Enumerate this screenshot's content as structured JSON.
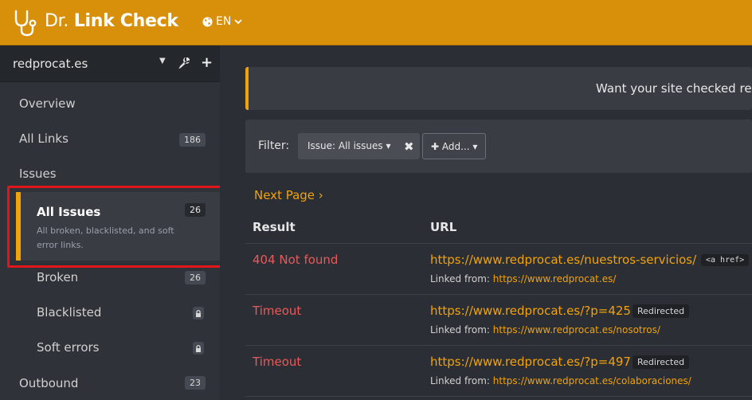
{
  "header": {
    "brand_prefix": "Dr.",
    "brand_strong": "Link Check",
    "language": "EN",
    "accent_color": "#d8900a"
  },
  "sidebar": {
    "site": "redprocat.es",
    "nav": {
      "overview": "Overview",
      "all_links": {
        "label": "All Links",
        "count": "186"
      },
      "issues": "Issues",
      "all_issues": {
        "label": "All Issues",
        "count": "26",
        "description": "All broken, blacklisted, and soft error links."
      },
      "broken": {
        "label": "Broken",
        "count": "26"
      },
      "blacklisted": {
        "label": "Blacklisted"
      },
      "soft_errors": {
        "label": "Soft errors"
      },
      "outbound": {
        "label": "Outbound",
        "count": "23"
      }
    }
  },
  "main": {
    "banner_text": "Want your site checked reg",
    "filter": {
      "label": "Filter:",
      "chip": "Issue:  All issues",
      "add": "Add..."
    },
    "next_page": "Next Page ›",
    "columns": {
      "result": "Result",
      "url": "URL"
    },
    "linked_from_label": "Linked from:",
    "rows": [
      {
        "result": "404 Not found",
        "url": "https://www.redprocat.es/nuestros-servicios/",
        "tag": "<a href>",
        "linked_from": "https://www.redprocat.es/"
      },
      {
        "result": "Timeout",
        "url": "https://www.redprocat.es/?p=425",
        "tag": "Redirected",
        "linked_from": "https://www.redprocat.es/nosotros/"
      },
      {
        "result": "Timeout",
        "url": "https://www.redprocat.es/?p=497",
        "tag": "Redirected",
        "linked_from": "https://www.redprocat.es/colaboraciones/"
      }
    ]
  }
}
